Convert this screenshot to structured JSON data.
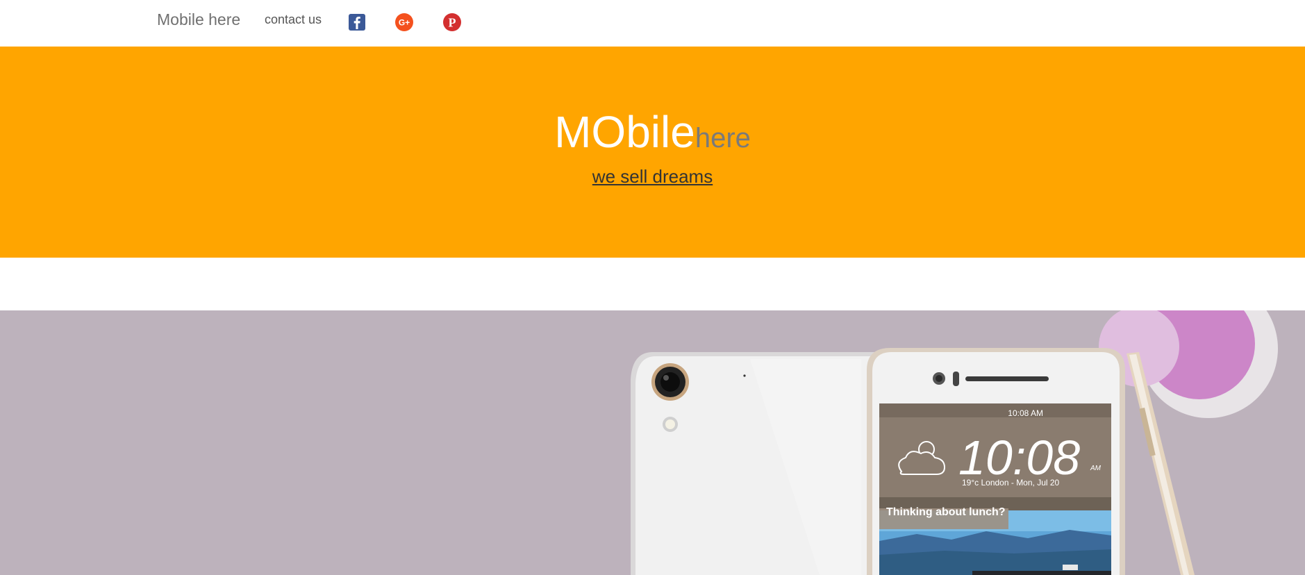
{
  "nav": {
    "brand": "Mobile here",
    "contact": "contact us",
    "social": [
      {
        "name": "facebook",
        "icon": "facebook-icon",
        "color": "#3b5998"
      },
      {
        "name": "google-plus",
        "icon": "google-plus-icon",
        "color": "#f4511e"
      },
      {
        "name": "pinterest",
        "icon": "pinterest-icon",
        "color": "#d32f2f"
      }
    ]
  },
  "hero": {
    "title_main": "MObile",
    "title_sub": "here",
    "tagline": "we sell dreams",
    "background": "#ffa500"
  },
  "banner": {
    "background": "#bdb2bc",
    "phone_screen": {
      "status_time": "10:08 AM",
      "clock": "10:08",
      "clock_suffix": "AM",
      "weather": "19°c  London - Mon, Jul 20",
      "card_title": "Thinking about lunch?"
    }
  }
}
